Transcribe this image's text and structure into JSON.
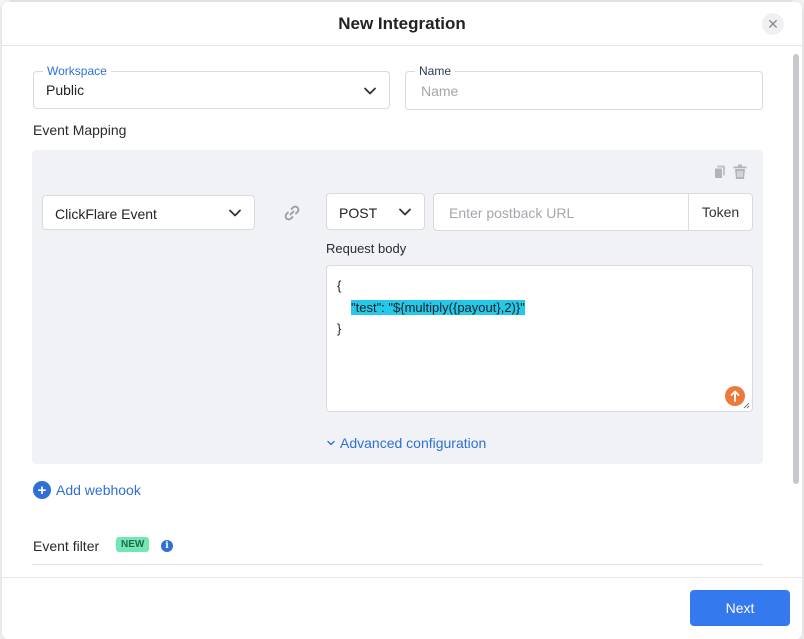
{
  "modal": {
    "title": "New Integration",
    "close_symbol": "✕"
  },
  "workspace": {
    "label": "Workspace",
    "value": "Public"
  },
  "name_field": {
    "label": "Name",
    "placeholder": "Name",
    "value": ""
  },
  "event_mapping": {
    "title": "Event Mapping",
    "event_select": "ClickFlare Event",
    "method_select": "POST",
    "url_placeholder": "Enter postback URL",
    "token_label": "Token",
    "request_body_label": "Request body",
    "body_lines": [
      "{",
      "\"test\": \"${multiply({payout},2)}\"",
      "}"
    ],
    "advanced_label": "Advanced configuration"
  },
  "add_webhook_label": "Add webhook",
  "event_filter": {
    "title": "Event filter",
    "badge": "NEW"
  },
  "footer": {
    "next_label": "Next"
  },
  "colors": {
    "primary": "#3579ee",
    "highlight": "#23c8ea",
    "badge_bg": "#72e6b4",
    "upload_badge": "#ec7a3a"
  },
  "icons": [
    "close-icon",
    "chevron-down-icon",
    "link-icon",
    "copy-icon",
    "trash-icon",
    "upload-icon",
    "plus-icon",
    "info-icon"
  ]
}
